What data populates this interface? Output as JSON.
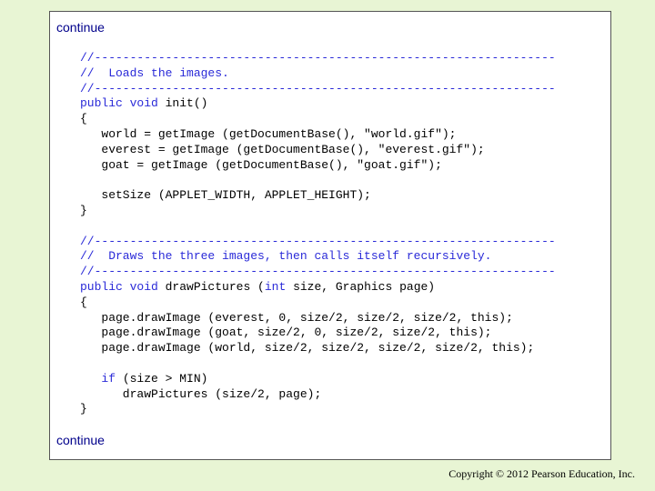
{
  "header": {
    "continue_label": "continue"
  },
  "footer": {
    "continue_label": "continue",
    "copyright": "Copyright © 2012 Pearson Education, Inc."
  },
  "code": {
    "lines": [
      [
        {
          "t": "//-----------------------------------------------------------------",
          "s": "c"
        }
      ],
      [
        {
          "t": "//  Loads the images.",
          "s": "c"
        }
      ],
      [
        {
          "t": "//-----------------------------------------------------------------",
          "s": "c"
        }
      ],
      [
        {
          "t": "public void",
          "s": "k"
        },
        {
          "t": " init()",
          "s": ""
        }
      ],
      [
        {
          "t": "{",
          "s": ""
        }
      ],
      [
        {
          "t": "   world = getImage (getDocumentBase(), \"world.gif\");",
          "s": ""
        }
      ],
      [
        {
          "t": "   everest = getImage (getDocumentBase(), \"everest.gif\");",
          "s": ""
        }
      ],
      [
        {
          "t": "   goat = getImage (getDocumentBase(), \"goat.gif\");",
          "s": ""
        }
      ],
      [
        {
          "t": "",
          "s": ""
        }
      ],
      [
        {
          "t": "   setSize (APPLET_WIDTH, APPLET_HEIGHT);",
          "s": ""
        }
      ],
      [
        {
          "t": "}",
          "s": ""
        }
      ],
      [
        {
          "t": "",
          "s": ""
        }
      ],
      [
        {
          "t": "//-----------------------------------------------------------------",
          "s": "c"
        }
      ],
      [
        {
          "t": "//  Draws the three images, then calls itself recursively.",
          "s": "c"
        }
      ],
      [
        {
          "t": "//-----------------------------------------------------------------",
          "s": "c"
        }
      ],
      [
        {
          "t": "public void",
          "s": "k"
        },
        {
          "t": " drawPictures (",
          "s": ""
        },
        {
          "t": "int",
          "s": "k"
        },
        {
          "t": " size, Graphics page)",
          "s": ""
        }
      ],
      [
        {
          "t": "{",
          "s": ""
        }
      ],
      [
        {
          "t": "   page.drawImage (everest, 0, size/2, size/2, size/2, this);",
          "s": ""
        }
      ],
      [
        {
          "t": "   page.drawImage (goat, size/2, 0, size/2, size/2, this);",
          "s": ""
        }
      ],
      [
        {
          "t": "   page.drawImage (world, size/2, size/2, size/2, size/2, this);",
          "s": ""
        }
      ],
      [
        {
          "t": "",
          "s": ""
        }
      ],
      [
        {
          "t": "   ",
          "s": ""
        },
        {
          "t": "if",
          "s": "k"
        },
        {
          "t": " (size > MIN)",
          "s": ""
        }
      ],
      [
        {
          "t": "      drawPictures (size/2, page);",
          "s": ""
        }
      ],
      [
        {
          "t": "}",
          "s": ""
        }
      ]
    ]
  },
  "colors": {
    "background": "#e8f5d4",
    "keyword": "#2a2ad8",
    "label": "#00008b"
  }
}
